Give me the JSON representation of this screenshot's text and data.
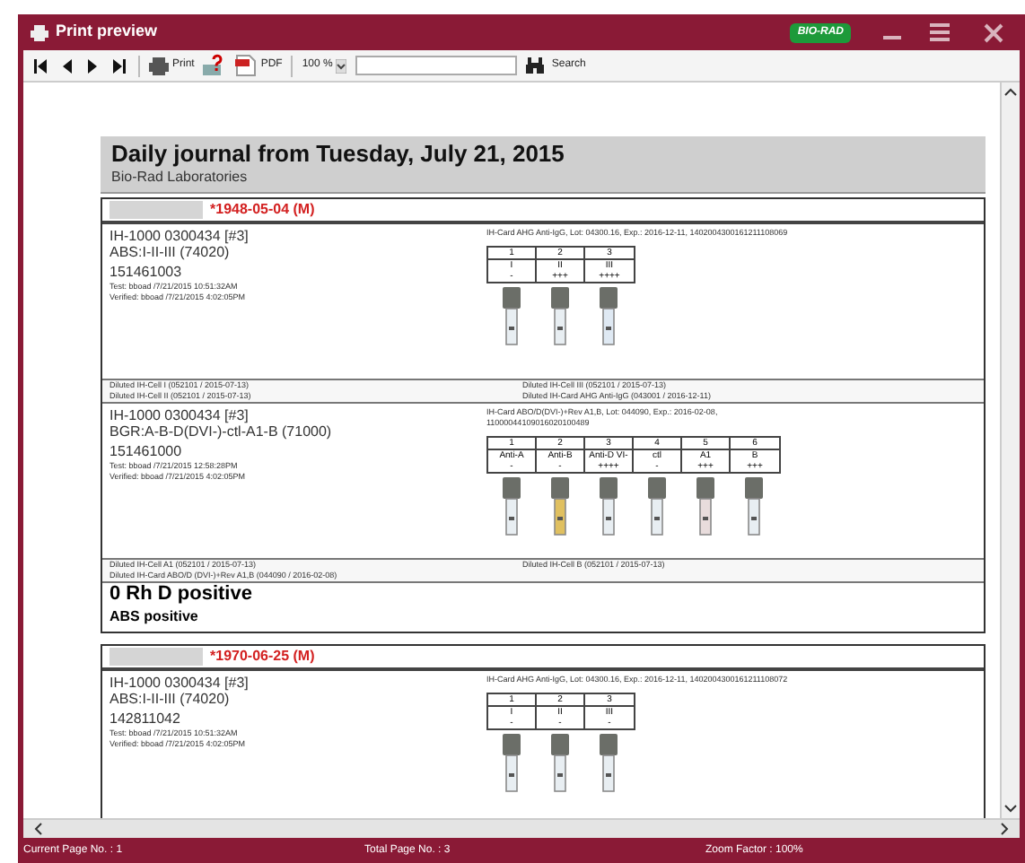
{
  "window": {
    "title": "Print preview",
    "logo": "BIO-RAD"
  },
  "toolbar": {
    "print": "Print",
    "pdf": "PDF",
    "zoom": "100 %",
    "search_button": "Search"
  },
  "report": {
    "title": "Daily journal from Tuesday, July 21, 2015",
    "subtitle": "Bio-Rad Laboratories"
  },
  "records": [
    {
      "birth": "*1948-05-04 (M)",
      "tests": [
        {
          "id": "IH-1000 0300434 [#3]",
          "test": "ABS:I-II-III (74020)",
          "sample": "151461003",
          "tested": "Test: bboad /7/21/2015  10:51:32AM",
          "verified": "Verified: bboad /7/21/2015  4:02:05PM",
          "card_lines": [
            "IH-Card AHG Anti-IgG, Lot: 04300.16, Exp.: 2016-12-11, 1402004300161211108069"
          ],
          "columns": [
            {
              "number": "1",
              "label": "I",
              "result": "-",
              "color": "#e8eef2"
            },
            {
              "number": "2",
              "label": "II",
              "result": "+++",
              "color": "#e8eef2"
            },
            {
              "number": "3",
              "label": "III",
              "result": "++++",
              "color": "#dfe9f3"
            }
          ],
          "diluted_left": [
            "Diluted IH-Cell I (052101 / 2015-07-13)",
            "Diluted IH-Cell II (052101 / 2015-07-13)"
          ],
          "diluted_right": [
            "Diluted IH-Cell III (052101 / 2015-07-13)",
            "Diluted IH-Card AHG Anti-IgG (043001 / 2016-12-11)"
          ]
        },
        {
          "id": "IH-1000 0300434 [#3]",
          "test": "BGR:A-B-D(DVI-)-ctl-A1-B (71000)",
          "sample": "151461000",
          "tested": "Test: bboad /7/21/2015  12:58:28PM",
          "verified": "Verified: bboad /7/21/2015  4:02:05PM",
          "card_lines": [
            "IH-Card ABO/D(DVI-)+Rev A1,B, Lot: 044090, Exp.: 2016-02-08,",
            "11000044109016020100489"
          ],
          "columns": [
            {
              "number": "1",
              "label": "Anti-A",
              "result": "-",
              "color": "#e8eef2"
            },
            {
              "number": "2",
              "label": "Anti-B",
              "result": "-",
              "color": "#e0c060"
            },
            {
              "number": "3",
              "label": "Anti-D VI-",
              "result": "++++",
              "color": "#e8eef2"
            },
            {
              "number": "4",
              "label": "ctl",
              "result": "-",
              "color": "#e8eef2"
            },
            {
              "number": "5",
              "label": "A1",
              "result": "+++",
              "color": "#e8dcdc"
            },
            {
              "number": "6",
              "label": "B",
              "result": "+++",
              "color": "#e8eef2"
            }
          ],
          "diluted_left": [
            "Diluted IH-Cell A1 (052101 / 2015-07-13)",
            "Diluted IH-Card ABO/D (DVI-)+Rev A1,B (044090 / 2016-02-08)"
          ],
          "diluted_right": [
            "Diluted IH-Cell B (052101 / 2015-07-13)"
          ]
        }
      ],
      "results": [
        {
          "kind": "main",
          "text": "0 Rh D positive"
        },
        {
          "kind": "sub",
          "text": "ABS positive"
        }
      ]
    },
    {
      "birth": "*1970-06-25 (M)",
      "tests": [
        {
          "id": "IH-1000 0300434 [#3]",
          "test": "ABS:I-II-III (74020)",
          "sample": "142811042",
          "tested": "Test: bboad /7/21/2015  10:51:32AM",
          "verified": "Verified: bboad /7/21/2015  4:02:05PM",
          "card_lines": [
            "IH-Card AHG Anti-IgG, Lot: 04300.16, Exp.: 2016-12-11, 1402004300161211108072"
          ],
          "columns": [
            {
              "number": "1",
              "label": "I",
              "result": "-",
              "color": "#e8eef2"
            },
            {
              "number": "2",
              "label": "II",
              "result": "-",
              "color": "#e8eef2"
            },
            {
              "number": "3",
              "label": "III",
              "result": "-",
              "color": "#e8eef2"
            }
          ]
        }
      ]
    }
  ],
  "status_bar": {
    "current_page": "Current Page No. : 1",
    "total_pages": "Total Page No. : 3",
    "zoom_factor": "Zoom Factor : 100%"
  }
}
